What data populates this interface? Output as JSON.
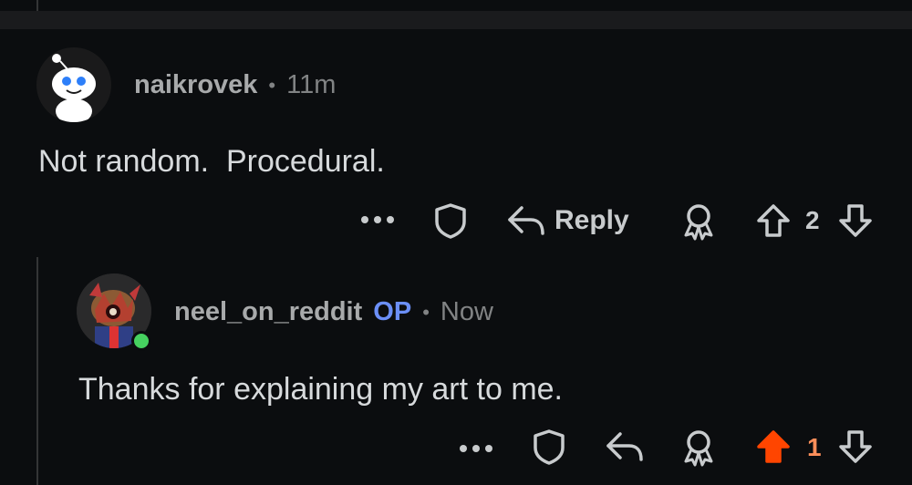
{
  "comments": [
    {
      "username": "naikrovek",
      "time": "11m",
      "body": "Not random.  Procedural.",
      "actions": {
        "reply_label": "Reply",
        "score": "2",
        "voted": "none"
      }
    },
    {
      "username": "neel_on_reddit",
      "op_label": "OP",
      "time": "Now",
      "body": "Thanks for explaining my art to me.",
      "actions": {
        "score": "1",
        "voted": "up"
      }
    }
  ],
  "separator": "•",
  "colors": {
    "background": "#0b0d0f",
    "text": "#d7dadc",
    "meta": "#818384",
    "op": "#6b8ff7",
    "upvote_active": "#ff4500",
    "online": "#46d160"
  },
  "icons": [
    "more-icon",
    "shield-icon",
    "reply-icon",
    "award-icon",
    "upvote-icon",
    "downvote-icon"
  ]
}
